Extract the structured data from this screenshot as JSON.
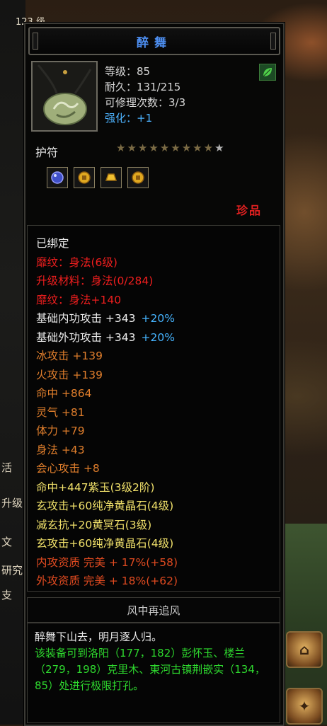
{
  "item": {
    "name": "醉舞",
    "level": "等级：85",
    "durability": "耐久：131/215",
    "repair": "可修理次数：3/3",
    "enhance": "强化：+1",
    "type": "护符",
    "rarity": "珍品",
    "stars": {
      "filled": 9,
      "total": 10
    },
    "icon": "jade-pendant-icon",
    "gem_icons": [
      "blue-gem-icon",
      "gold-coin-icon",
      "gold-ingot-icon",
      "gold-coin-icon"
    ]
  },
  "attributes": [
    {
      "text": "已绑定",
      "color": "white"
    },
    {
      "text": "靡纹：身法(6级)",
      "color": "red"
    },
    {
      "text": "升级材料：身法(0/284)",
      "color": "red"
    },
    {
      "text": "靡纹：身法+140",
      "color": "red"
    },
    {
      "text": "基础内功攻击 +343",
      "extra": "+20%",
      "color": "white"
    },
    {
      "text": "基础外功攻击 +343",
      "extra": "+20%",
      "color": "white"
    },
    {
      "text": "冰攻击 +139",
      "color": "orange"
    },
    {
      "text": "火攻击 +139",
      "color": "orange"
    },
    {
      "text": "命中 +864",
      "color": "orange"
    },
    {
      "text": "灵气 +81",
      "color": "orange"
    },
    {
      "text": "体力 +79",
      "color": "orange"
    },
    {
      "text": "身法 +43",
      "color": "orange"
    },
    {
      "text": "会心攻击 +8",
      "color": "orange"
    },
    {
      "text": "命中+447紫玉(3级2阶)",
      "color": "yellow"
    },
    {
      "text": "玄攻击+60纯净黄晶石(4级)",
      "color": "yellow"
    },
    {
      "text": "减玄抗+20黄冥石(3级)",
      "color": "yellow"
    },
    {
      "text": "玄攻击+60纯净黄晶石(4级)",
      "color": "yellow"
    },
    {
      "text": "内攻资质  完美  + 17%(+58)",
      "color": "redorange"
    },
    {
      "text": "外攻资质  完美  + 18%(+62)",
      "color": "redorange"
    }
  ],
  "set_title": "风中再追风",
  "description": {
    "line1": "醉舞下山去，明月逐人归。",
    "hint": "该装备可到洛阳（177，182）彭怀玉、楼兰（279，198）克里木、東河古镇荆嵌实（134，85）处进行极限打孔。"
  },
  "background": {
    "left_labels": [
      "活",
      "升级",
      "文",
      "研究",
      "支"
    ],
    "top_fragment": "123 级"
  },
  "colors": {
    "title": "#4d8ef0",
    "red": "#f01e1e",
    "orange": "#e07e2c",
    "yellow": "#f0e06a",
    "green": "#2ed82e",
    "blue": "#46b4ff"
  }
}
